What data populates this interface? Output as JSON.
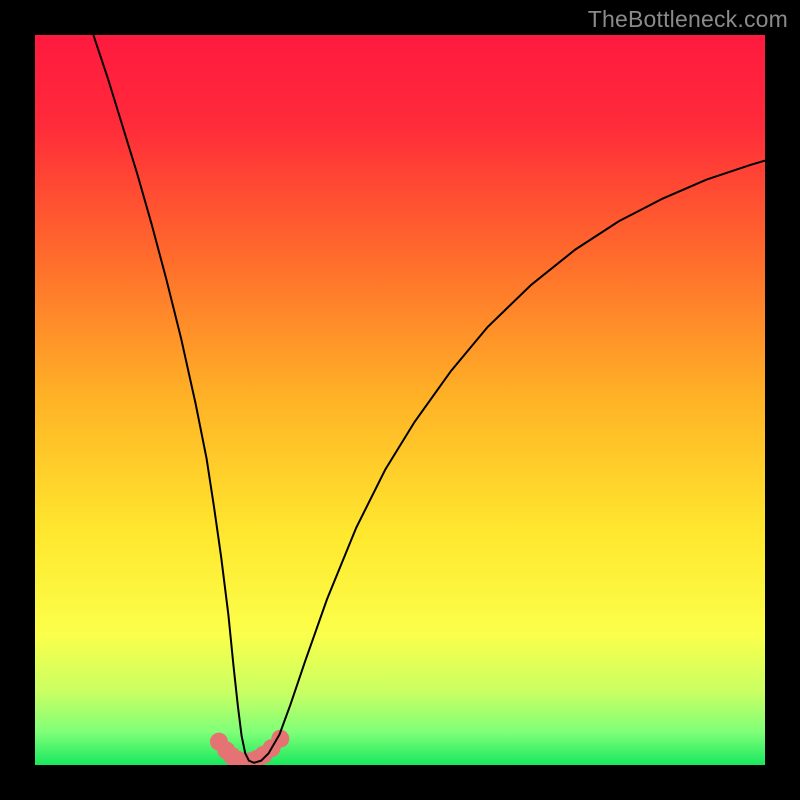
{
  "watermark": "TheBottleneck.com",
  "chart_data": {
    "type": "line",
    "title": "",
    "xlabel": "",
    "ylabel": "",
    "xlim": [
      0,
      100
    ],
    "ylim": [
      0,
      100
    ],
    "grid": false,
    "legend": false,
    "gradient_stops": [
      {
        "offset": 0.0,
        "color": "#ff1a3f"
      },
      {
        "offset": 0.12,
        "color": "#ff2a3a"
      },
      {
        "offset": 0.3,
        "color": "#ff6a2c"
      },
      {
        "offset": 0.5,
        "color": "#ffb326"
      },
      {
        "offset": 0.68,
        "color": "#ffe72e"
      },
      {
        "offset": 0.82,
        "color": "#fbff4a"
      },
      {
        "offset": 0.9,
        "color": "#c9ff63"
      },
      {
        "offset": 0.955,
        "color": "#7fff78"
      },
      {
        "offset": 1.0,
        "color": "#18e85e"
      }
    ],
    "series": [
      {
        "name": "bottleneck-curve",
        "color": "#000000",
        "width": 2.0,
        "x": [
          8,
          10,
          12,
          14,
          16,
          18,
          20,
          22,
          23.5,
          24.5,
          25.5,
          26.5,
          27.2,
          27.8,
          28.3,
          28.8,
          29.3,
          30,
          31,
          32,
          33.5,
          35,
          37,
          40,
          44,
          48,
          52,
          57,
          62,
          68,
          74,
          80,
          86,
          92,
          98,
          100
        ],
        "y": [
          100,
          94,
          87.5,
          81,
          74,
          66.5,
          58.5,
          49.5,
          42,
          35.5,
          28.5,
          20.5,
          13.5,
          8,
          4,
          1.6,
          0.6,
          0.3,
          0.6,
          1.6,
          4.2,
          8.3,
          14.2,
          22.7,
          32.5,
          40.5,
          47,
          54,
          60,
          65.8,
          70.6,
          74.5,
          77.6,
          80.2,
          82.2,
          82.8
        ]
      },
      {
        "name": "bottom-marker-band",
        "type": "marker",
        "color": "#e57373",
        "radius": 9,
        "x": [
          25.2,
          26.2,
          27.0,
          27.8,
          28.6,
          29.4,
          30.3,
          31.3,
          32.4,
          33.6
        ],
        "y": [
          3.2,
          2.0,
          1.2,
          0.7,
          0.5,
          0.5,
          0.8,
          1.4,
          2.3,
          3.6
        ]
      }
    ]
  }
}
